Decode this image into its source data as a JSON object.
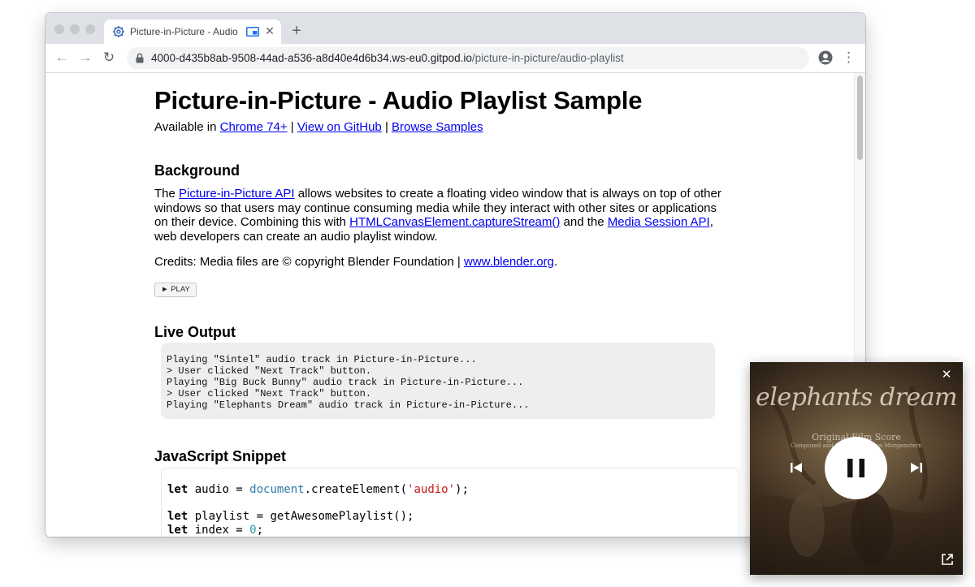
{
  "tab": {
    "title": "Picture-in-Picture - Audio Playlist Sample",
    "favicon": "gear-icon"
  },
  "toolbar": {
    "url_host": "4000-d435b8ab-9508-44ad-a536-a8d40e4d6b34.ws-eu0.gitpod.io",
    "url_path": "/picture-in-picture/audio-playlist"
  },
  "page": {
    "title": "Picture-in-Picture - Audio Playlist Sample",
    "available_prefix": "Available in ",
    "chrome_link": "Chrome 74+",
    "separator": " | ",
    "github_link": "View on GitHub",
    "samples_link": "Browse Samples",
    "background_heading": "Background",
    "background_parts": {
      "p1": "The ",
      "link1": "Picture-in-Picture API",
      "p2": " allows websites to create a floating video window that is always on top of other windows so that users may continue consuming media while they interact with other sites or applications on their device. Combining this with ",
      "link2": "HTMLCanvasElement.captureStream()",
      "p3": " and the ",
      "link3": "Media Session API",
      "p4": ", web developers can create an audio playlist window."
    },
    "credits_prefix": "Credits: Media files are © copyright Blender Foundation | ",
    "credits_link": "www.blender.org",
    "credits_suffix": ".",
    "play_button": "► PLAY",
    "live_output_heading": "Live Output",
    "log_lines": [
      "Playing \"Sintel\" audio track in Picture-in-Picture...",
      "> User clicked \"Next Track\" button.",
      "Playing \"Big Buck Bunny\" audio track in Picture-in-Picture...",
      "> User clicked \"Next Track\" button.",
      "Playing \"Elephants Dream\" audio track in Picture-in-Picture..."
    ],
    "snippet_heading": "JavaScript Snippet",
    "code": {
      "l1_kw": "let",
      "l1_a": " audio = ",
      "l1_obj": "document",
      "l1_b": ".createElement(",
      "l1_str": "'audio'",
      "l1_c": ");",
      "l2_kw": "let",
      "l2_a": " playlist = getAwesomePlaylist();",
      "l3_kw": "let",
      "l3_a": " index = ",
      "l3_num": "0",
      "l3_b": ";"
    }
  },
  "pip": {
    "art_title": "elephants dream",
    "art_sub1": "Original Film Score",
    "art_sub2": "Composed and Produced by Jan Morgenstern",
    "controls": [
      "close-icon",
      "previous-track-icon",
      "pause-icon",
      "next-track-icon",
      "back-to-tab-icon"
    ]
  },
  "colors": {
    "link": "#0000ee",
    "tabstrip": "#dee1e6",
    "output_bg": "#eeeeee"
  }
}
